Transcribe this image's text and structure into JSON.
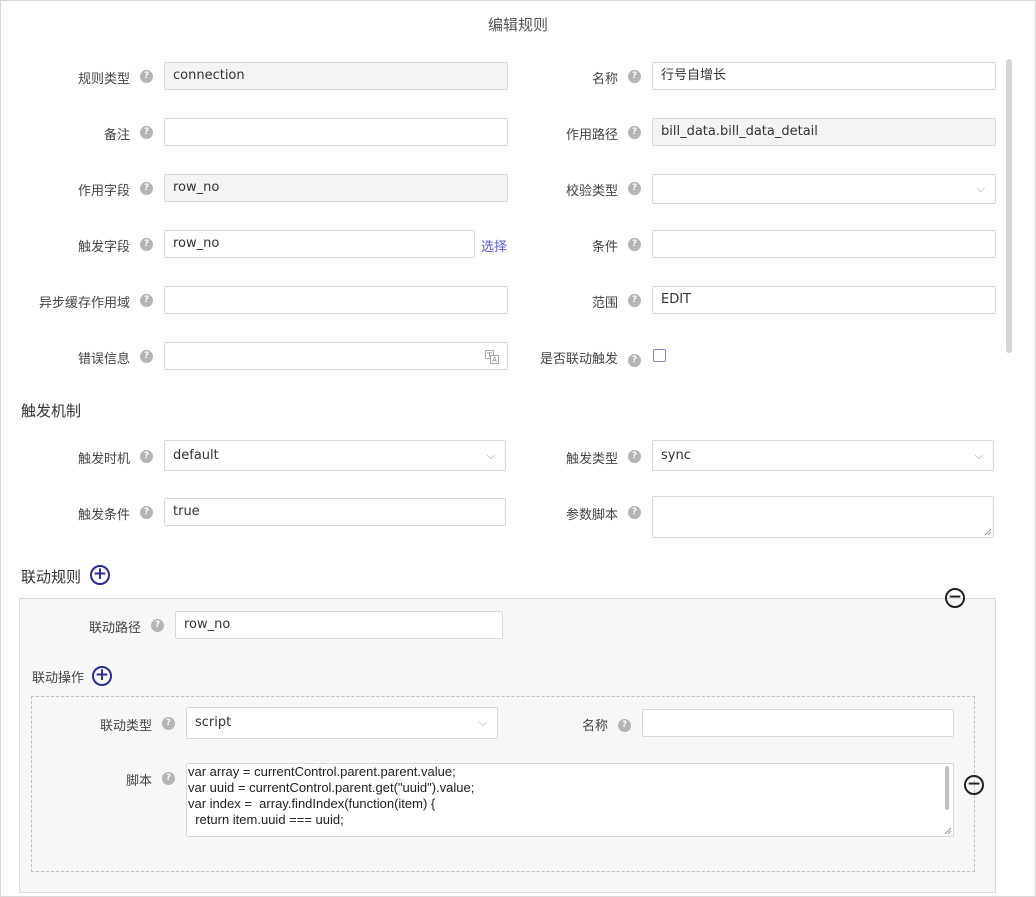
{
  "dialog_title": "编辑规则",
  "fields": {
    "rule_type": {
      "label": "规则类型",
      "value": "connection"
    },
    "name": {
      "label": "名称",
      "value": "行号自增长"
    },
    "remark": {
      "label": "备注",
      "value": ""
    },
    "path": {
      "label": "作用路径",
      "value": "bill_data.bill_data_detail"
    },
    "field": {
      "label": "作用字段",
      "value": "row_no"
    },
    "check_type": {
      "label": "校验类型",
      "value": ""
    },
    "trigger_field": {
      "label": "触发字段",
      "value": "row_no",
      "link": "选择"
    },
    "condition": {
      "label": "条件",
      "value": ""
    },
    "async_cache": {
      "label": "异步缓存作用域",
      "value": ""
    },
    "scope": {
      "label": "范围",
      "value": "EDIT"
    },
    "error_msg": {
      "label": "错误信息",
      "value": ""
    },
    "linked_trigger": {
      "label": "是否联动触发"
    }
  },
  "trigger_mechanism": {
    "title": "触发机制",
    "timing": {
      "label": "触发时机",
      "value": "default"
    },
    "type": {
      "label": "触发类型",
      "value": "sync"
    },
    "condition": {
      "label": "触发条件",
      "value": "true"
    },
    "param_script": {
      "label": "参数脚本",
      "value": ""
    }
  },
  "linkage_rules": {
    "title": "联动规则",
    "path": {
      "label": "联动路径",
      "value": "row_no"
    },
    "operations_title": "联动操作",
    "op": {
      "type": {
        "label": "联动类型",
        "value": "script"
      },
      "name": {
        "label": "名称",
        "value": ""
      },
      "script": {
        "label": "脚本",
        "lines": [
          "var array = currentControl.parent.parent.value;",
          "var uuid = currentControl.parent.get(\"uuid\").value;",
          "var index =  array.findIndex(function(item) {",
          "  return item.uuid === uuid;"
        ]
      }
    }
  },
  "help_glyph": "?",
  "plus_glyph": "+",
  "minus_glyph": "−",
  "chevron_glyph": "⌵"
}
